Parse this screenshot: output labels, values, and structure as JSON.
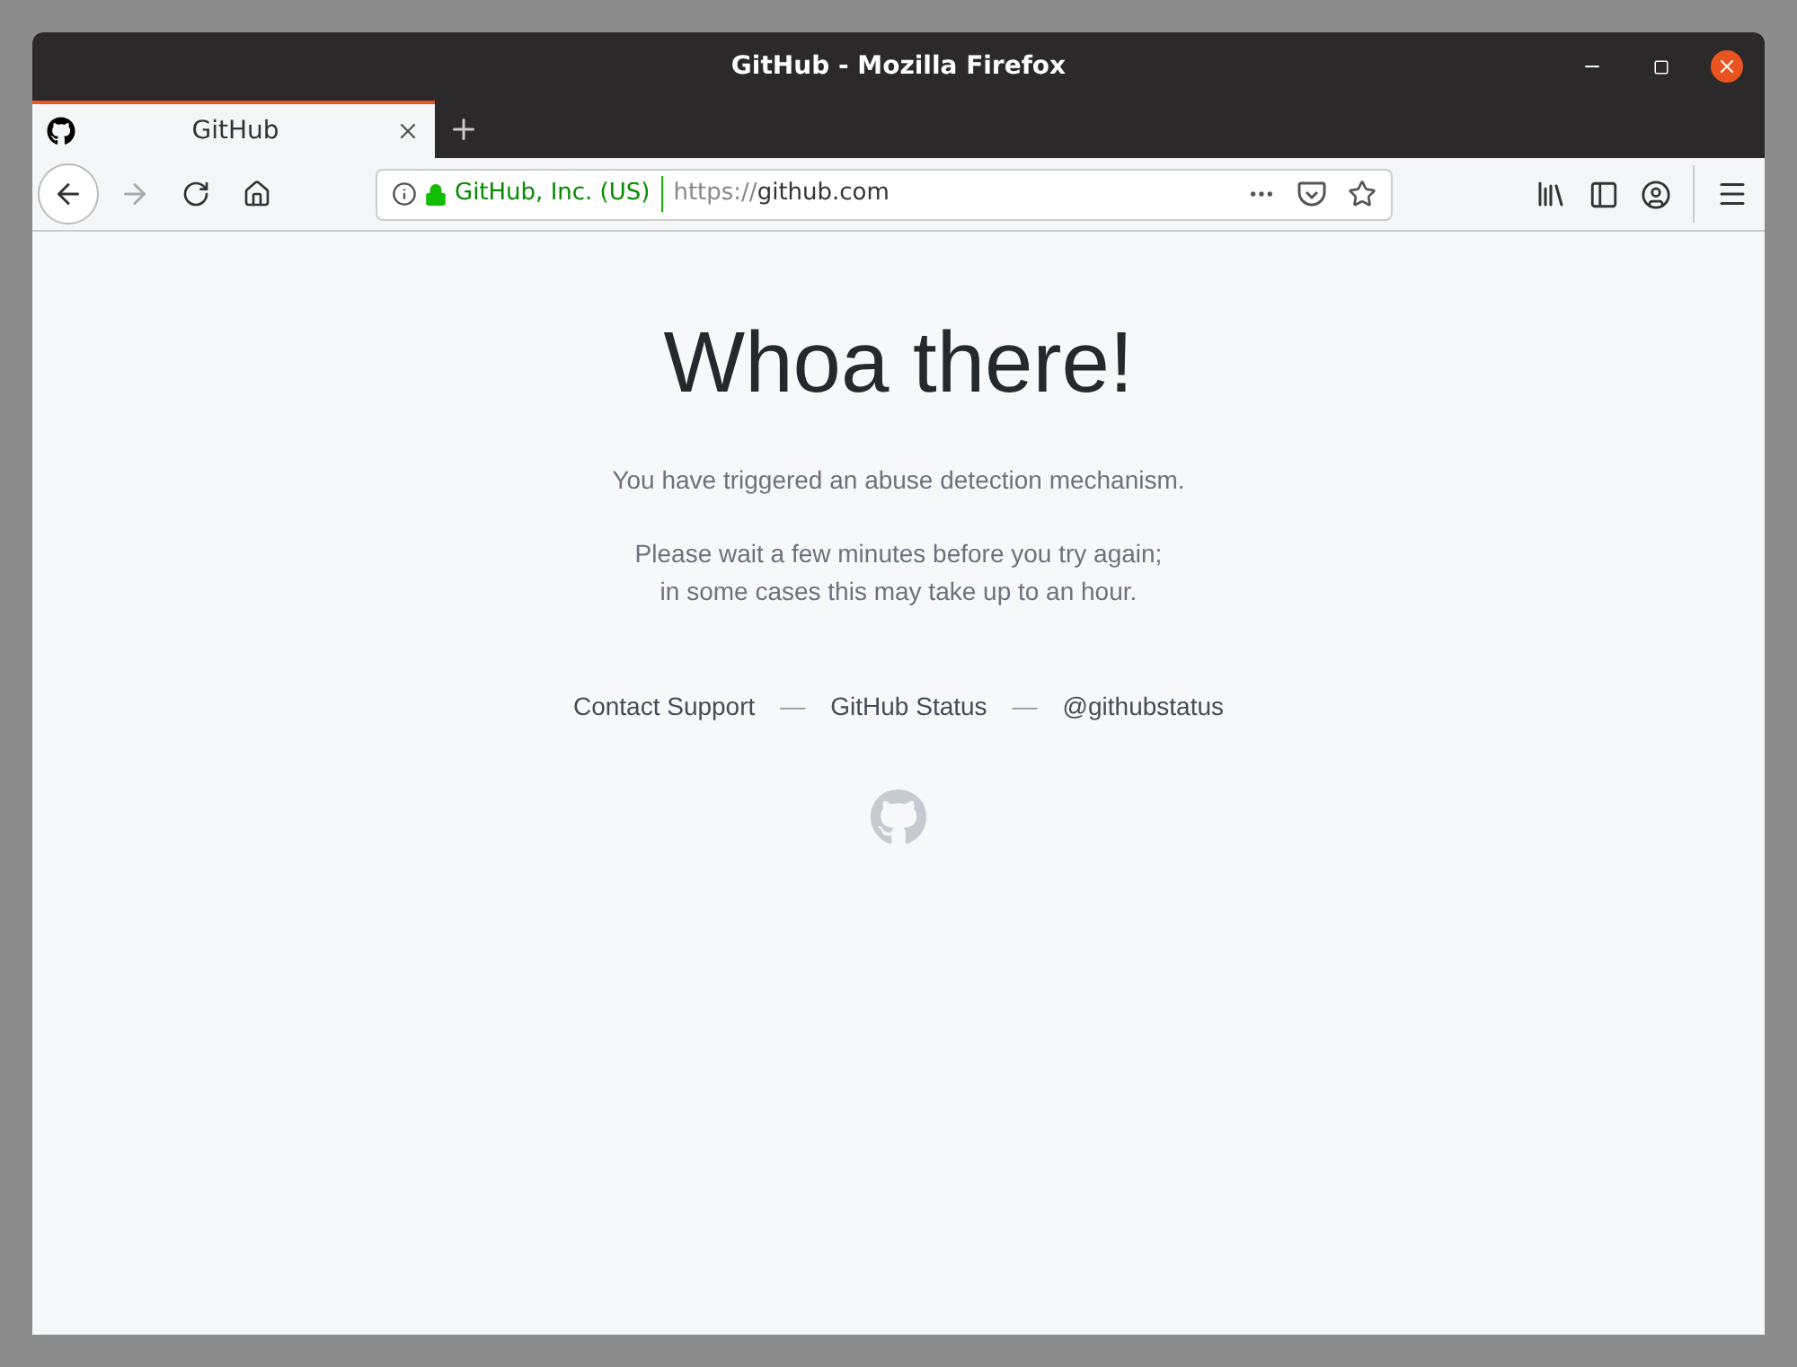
{
  "window": {
    "title": "GitHub - Mozilla Firefox"
  },
  "tabs": [
    {
      "label": "GitHub",
      "selected": true
    }
  ],
  "address_bar": {
    "identity": "GitHub, Inc. (US)",
    "url_scheme": "https://",
    "url_host": "github.com"
  },
  "page": {
    "heading": "Whoa there!",
    "paragraphs": [
      [
        "You have triggered an abuse detection mechanism."
      ],
      [
        "Please wait a few minutes before you try again;",
        "in some cases this may take up to an hour."
      ]
    ],
    "footer_items": [
      {
        "kind": "link",
        "text": "Contact Support"
      },
      {
        "kind": "separator",
        "text": "—"
      },
      {
        "kind": "link",
        "text": "GitHub Status"
      },
      {
        "kind": "separator",
        "text": "—"
      },
      {
        "kind": "link",
        "text": "@githubstatus"
      }
    ]
  }
}
